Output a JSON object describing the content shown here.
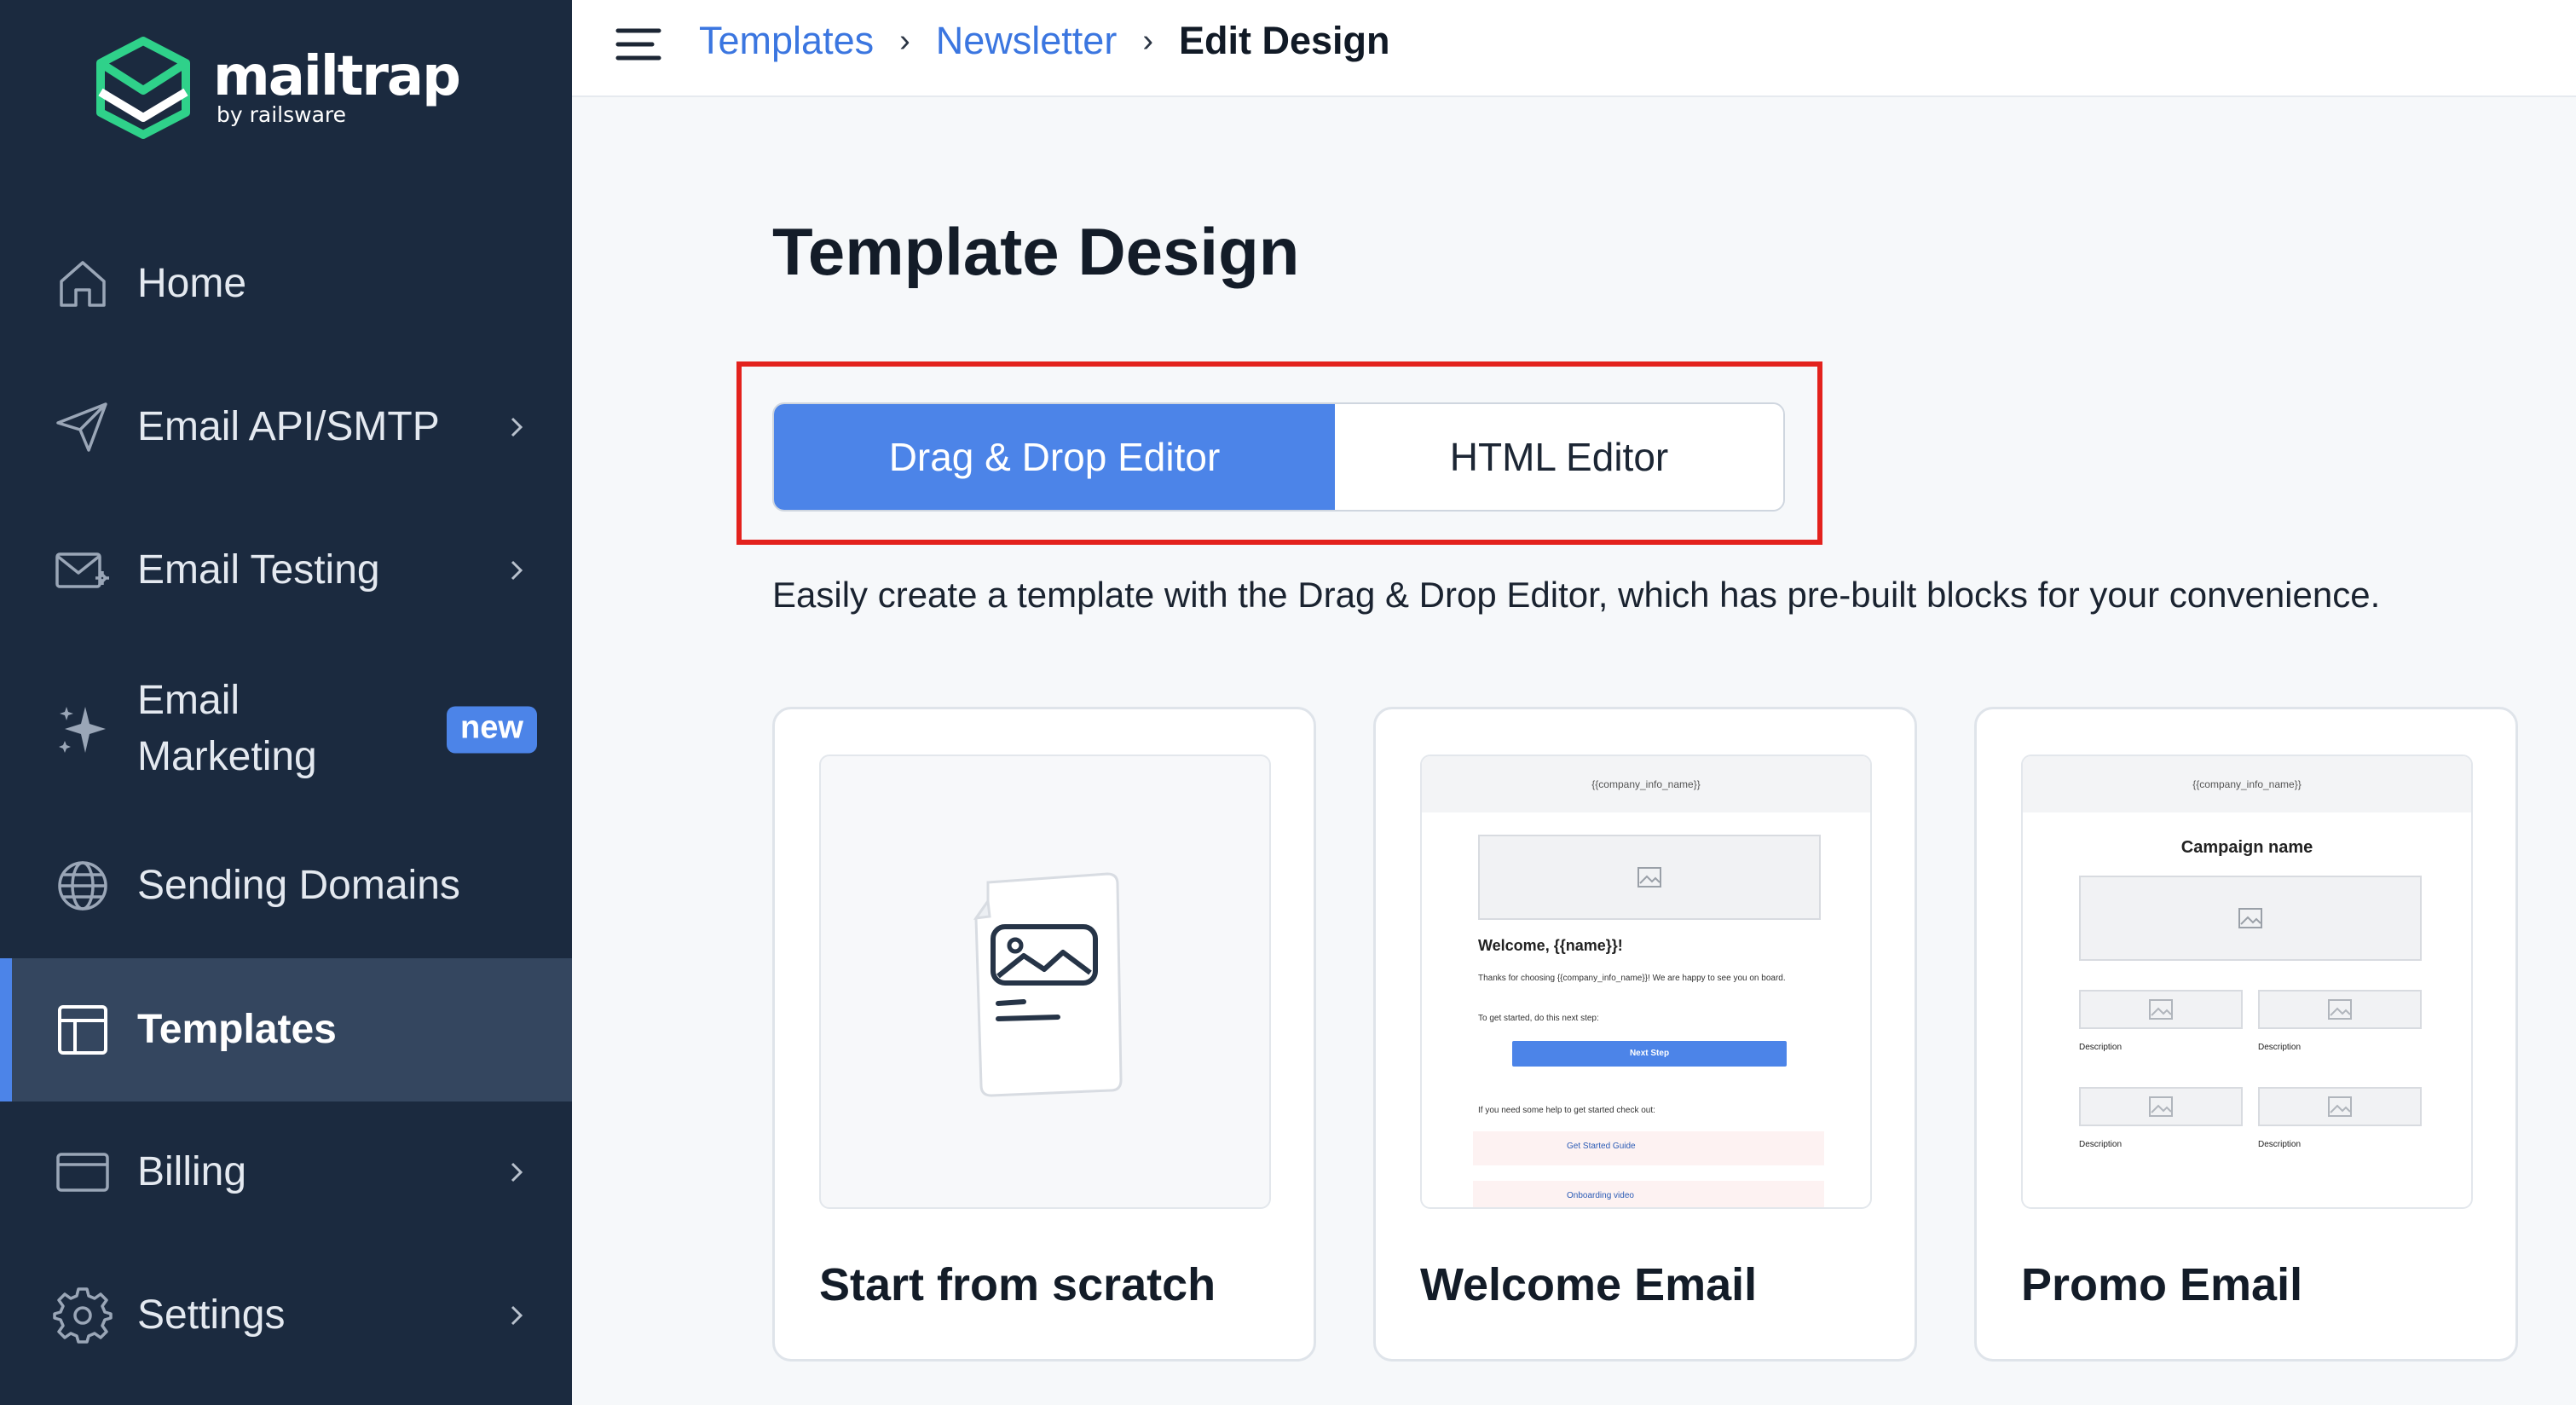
{
  "brand": {
    "name": "mailtrap",
    "tagline": "by railsware"
  },
  "sidebar": {
    "items": [
      {
        "label": "Home",
        "icon": "home-icon"
      },
      {
        "label": "Email API/SMTP",
        "icon": "send-icon"
      },
      {
        "label": "Email Testing",
        "icon": "envelope-test-icon"
      },
      {
        "label": "Email Marketing",
        "label_line1": "Email",
        "label_line2": "Marketing",
        "badge": "new",
        "icon": "sparkle-icon"
      },
      {
        "label": "Sending Domains",
        "icon": "globe-icon"
      },
      {
        "label": "Templates",
        "icon": "template-icon",
        "active": true
      },
      {
        "label": "Billing",
        "icon": "credit-card-icon"
      },
      {
        "label": "Settings",
        "icon": "gear-icon"
      }
    ]
  },
  "breadcrumb": {
    "items": [
      "Templates",
      "Newsletter"
    ],
    "current": "Edit Design",
    "separator": "›"
  },
  "main": {
    "title": "Template Design",
    "editor_toggle": {
      "selected": "Drag & Drop Editor",
      "options": [
        "Drag & Drop Editor",
        "HTML Editor"
      ]
    },
    "description": "Easily create a template with the Drag & Drop Editor, which has pre-built blocks for your convenience.",
    "cards": [
      {
        "title": "Start from scratch"
      },
      {
        "title": "Welcome Email",
        "preview": {
          "header": "{{company_info_name}}",
          "heading": "Welcome, {{name}}!",
          "body": "Thanks for choosing {{company_info_name}}! We are happy to see you on board.",
          "step_text": "To get started, do this next step:",
          "button": "Next Step",
          "help_text": "If you need some help to get started check out:",
          "links": [
            "Get Started Guide",
            "Onboarding video"
          ]
        }
      },
      {
        "title": "Promo Email",
        "preview": {
          "header": "{{company_info_name}}",
          "heading": "Campaign name",
          "item_label": "Description"
        }
      }
    ]
  },
  "colors": {
    "sidebar_bg": "#1b2a3f",
    "sidebar_active": "#34465f",
    "accent": "#4c84e8",
    "link": "#3b76e0",
    "highlight": "#e3221d",
    "brand_green": "#2fd18a"
  }
}
